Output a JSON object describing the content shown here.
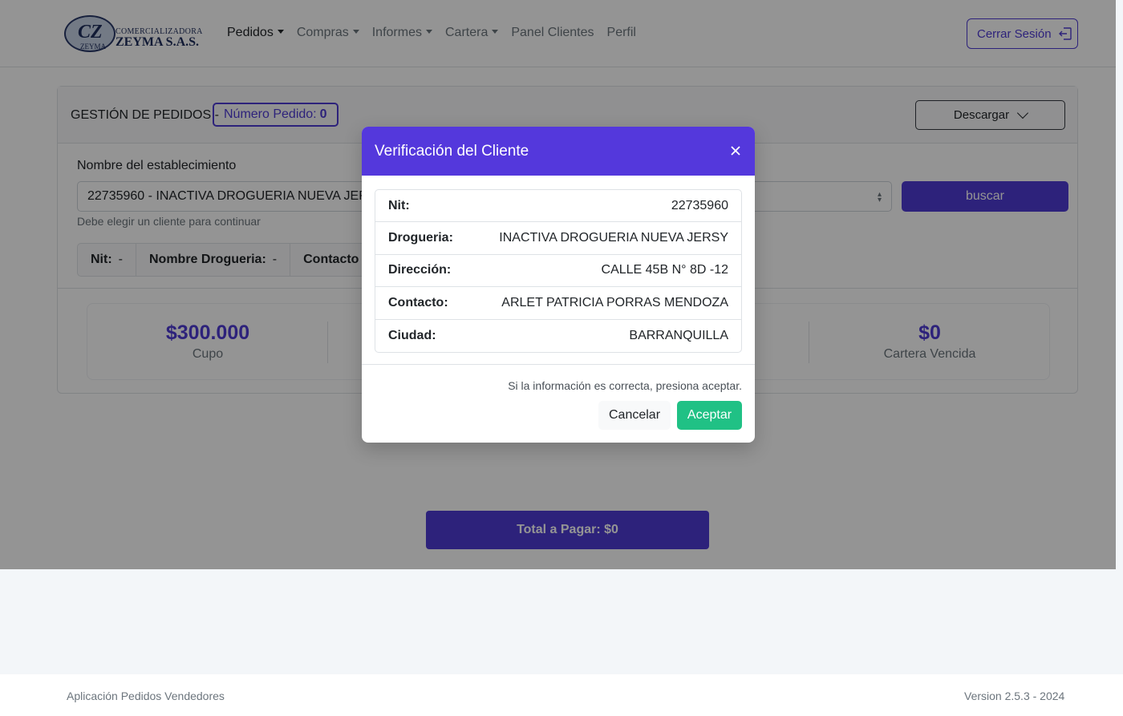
{
  "brand": {
    "mark": "CZ",
    "mark_sub": "ZEYMA",
    "line1": "COMERCIALIZADORA",
    "line2": "ZEYMA S.A.S."
  },
  "nav": {
    "items": [
      {
        "label": "Pedidos",
        "dropdown": true,
        "active": true
      },
      {
        "label": "Compras",
        "dropdown": true
      },
      {
        "label": "Informes",
        "dropdown": true
      },
      {
        "label": "Cartera",
        "dropdown": true
      },
      {
        "label": "Panel Clientes"
      },
      {
        "label": "Perfil"
      }
    ],
    "logout_label": "Cerrar Sesión"
  },
  "orders": {
    "title": "GESTIÓN DE PEDIDOS -",
    "order_label": "Número Pedido:",
    "order_number": "0",
    "download_label": "Descargar",
    "establishment_label": "Nombre del establecimiento",
    "establishment_value": "22735960 - INACTIVA DROGUERIA NUEVA JERSY",
    "search_label": "buscar",
    "hint": "Debe elegir un cliente para continuar",
    "info": {
      "nit_label": "Nit:",
      "nit_value": "-",
      "name_label": "Nombre Drogueria:",
      "name_value": "-",
      "contact_label": "Contacto"
    },
    "stats": {
      "cupo_value": "$300.000",
      "cupo_label": "Cupo",
      "cartera_value": "$0",
      "cartera_label": "Cartera Vencida"
    },
    "total_label": "Total a Pagar: $0"
  },
  "modal": {
    "title": "Verificación del Cliente",
    "rows": [
      {
        "key": "Nit:",
        "value": "22735960"
      },
      {
        "key": "Drogueria:",
        "value": "INACTIVA DROGUERIA NUEVA JERSY"
      },
      {
        "key": "Dirección:",
        "value": "CALLE 45B N° 8D -12"
      },
      {
        "key": "Contacto:",
        "value": "ARLET PATRICIA PORRAS MENDOZA"
      },
      {
        "key": "Ciudad:",
        "value": "BARRANQUILLA"
      }
    ],
    "note": "Si la información es correcta, presiona aceptar.",
    "cancel_label": "Cancelar",
    "accept_label": "Aceptar"
  },
  "footer": {
    "left": "Aplicación Pedidos Vendedores",
    "right": "Version 2.5.3 - 2024"
  },
  "colors": {
    "primary": "#4f3bd4",
    "modal_header": "#5438dc",
    "accept": "#20c185"
  }
}
